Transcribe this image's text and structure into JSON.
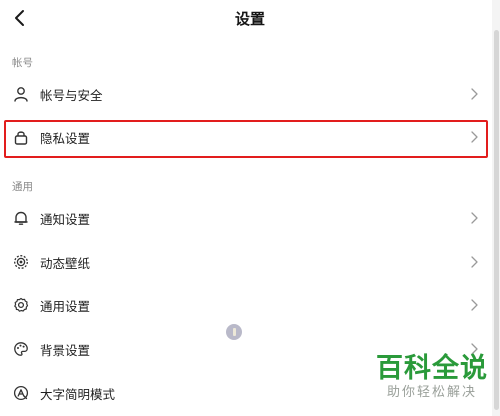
{
  "header": {
    "title": "设置"
  },
  "sections": {
    "account": {
      "label": "帐号",
      "items": [
        {
          "label": "帐号与安全",
          "icon": "user-icon"
        },
        {
          "label": "隐私设置",
          "icon": "lock-icon",
          "highlighted": true
        }
      ]
    },
    "general": {
      "label": "通用",
      "items": [
        {
          "label": "通知设置",
          "icon": "bell-icon"
        },
        {
          "label": "动态壁纸",
          "icon": "dynamic-wallpaper-icon"
        },
        {
          "label": "通用设置",
          "icon": "gear-icon"
        },
        {
          "label": "背景设置",
          "icon": "palette-icon"
        },
        {
          "label": "大字简明模式",
          "icon": "large-text-icon"
        }
      ]
    }
  },
  "watermark": {
    "brand": "百科全说",
    "slogan": "助你轻松解决"
  },
  "colors": {
    "highlight": "#e21d1d",
    "watermark_brand": "#2a9a3a",
    "section_label": "#8a8a8a"
  }
}
